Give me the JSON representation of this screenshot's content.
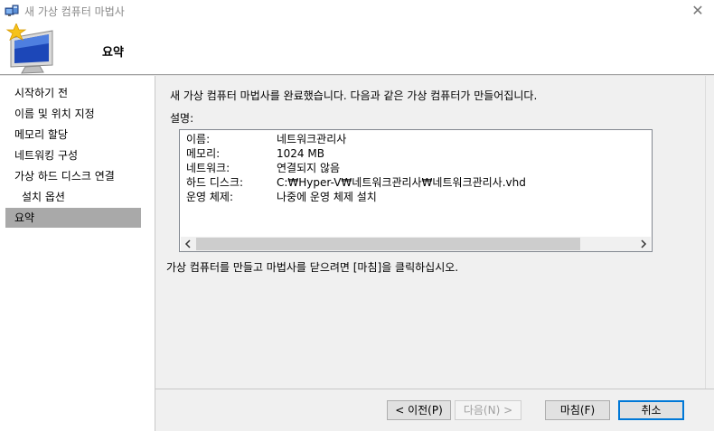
{
  "window": {
    "title": "새 가상 컴퓨터 마법사",
    "close": "✕"
  },
  "header": {
    "title": "요약"
  },
  "sidebar": {
    "items": [
      {
        "label": "시작하기 전"
      },
      {
        "label": "이름 및 위치 지정"
      },
      {
        "label": "메모리 할당"
      },
      {
        "label": "네트워킹 구성"
      },
      {
        "label": "가상 하드 디스크 연결"
      },
      {
        "label": "설치 옵션"
      },
      {
        "label": "요약"
      }
    ],
    "selected": "요약"
  },
  "content": {
    "intro": "새 가상 컴퓨터 마법사를 완료했습니다. 다음과 같은 가상 컴퓨터가 만들어집니다.",
    "description_label": "설명:",
    "summary": [
      {
        "key": "이름:",
        "value": "네트워크관리사"
      },
      {
        "key": "메모리:",
        "value": "1024 MB"
      },
      {
        "key": "네트워크:",
        "value": "연결되지 않음"
      },
      {
        "key": "하드 디스크:",
        "value": "C:₩Hyper-V₩네트워크관리사₩네트워크관리사.vhd"
      },
      {
        "key": "운영 체제:",
        "value": "나중에 운영 체제 설치"
      }
    ],
    "hint": "가상 컴퓨터를 만들고 마법사를 닫으려면 [마침]을 클릭하십시오."
  },
  "buttons": {
    "previous": "< 이전(P)",
    "next": "다음(N) >",
    "finish": "마침(F)",
    "cancel": "취소"
  },
  "colors": {
    "selected_nav": "#a9a9a9",
    "panel": "#f0f0f0",
    "default_button_border": "#0078d7"
  },
  "icons": {
    "window": "hyper-v-wizard-icon",
    "header": "computer-monitor-star-icon",
    "close": "close-icon",
    "scroll_left": "chevron-left-icon",
    "scroll_right": "chevron-right-icon"
  }
}
